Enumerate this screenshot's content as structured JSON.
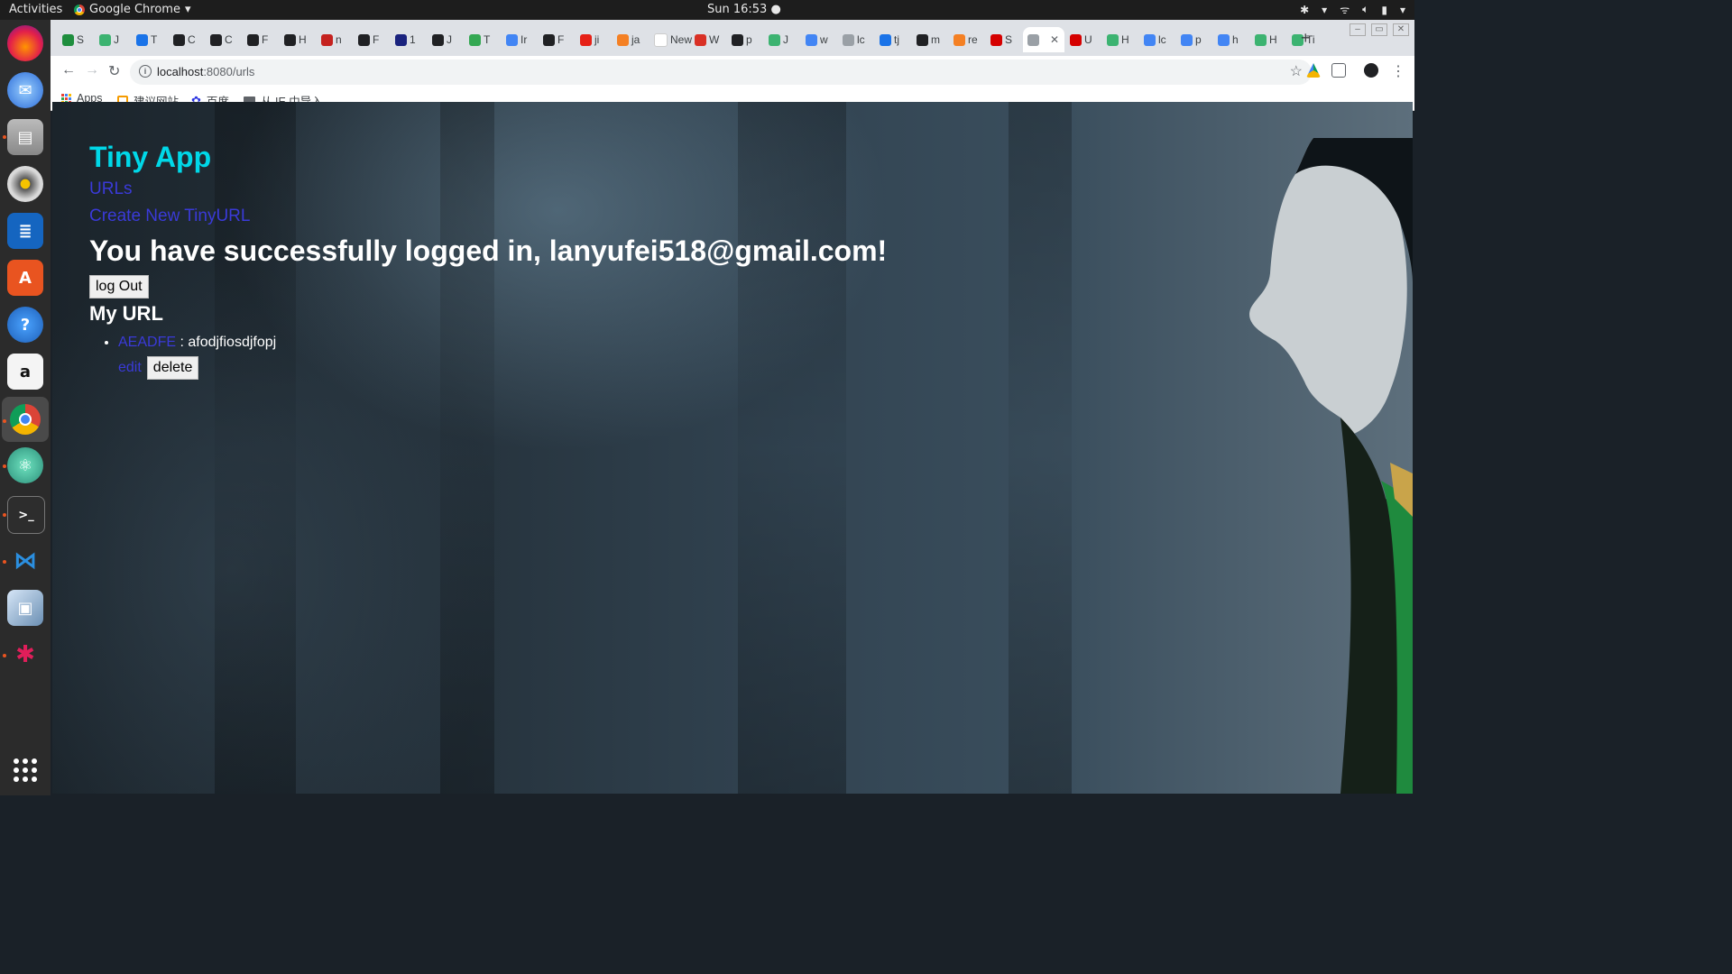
{
  "system_bar": {
    "activities": "Activities",
    "app_name": "Google Chrome",
    "clock": "Sun 16:53"
  },
  "dock": {
    "items": [
      "firefox-icon",
      "thunderbird-icon",
      "files-icon",
      "rhythmbox-icon",
      "writer-icon",
      "software-icon",
      "help-icon",
      "amazon-icon",
      "chrome-icon",
      "atom-icon",
      "terminal-icon",
      "vscode-icon",
      "image-viewer-icon",
      "slack-icon"
    ]
  },
  "browser": {
    "tabs": [
      {
        "label": "S",
        "color": "#1e8e3e"
      },
      {
        "label": "J",
        "color": "#3cb371"
      },
      {
        "label": "T",
        "color": "#1a73e8"
      },
      {
        "label": "C",
        "color": "#202124"
      },
      {
        "label": "C",
        "color": "#202124"
      },
      {
        "label": "F",
        "color": "#202124"
      },
      {
        "label": "H",
        "color": "#202124"
      },
      {
        "label": "n",
        "color": "#c5221f"
      },
      {
        "label": "F",
        "color": "#202124"
      },
      {
        "label": "1",
        "color": "#1a237e"
      },
      {
        "label": "J",
        "color": "#202124"
      },
      {
        "label": "T",
        "color": "#34a853"
      },
      {
        "label": "Ir",
        "color": "#4285f4"
      },
      {
        "label": "F",
        "color": "#202124"
      },
      {
        "label": "ji",
        "color": "#e62117"
      },
      {
        "label": "ja",
        "color": "#f48024"
      },
      {
        "label": "New",
        "color": "#ffffff"
      },
      {
        "label": "W",
        "color": "#d93025"
      },
      {
        "label": "p",
        "color": "#202124"
      },
      {
        "label": "J",
        "color": "#3cb371"
      },
      {
        "label": "w",
        "color": "#4285f4"
      },
      {
        "label": "lc",
        "color": "#9aa0a6"
      },
      {
        "label": "tj",
        "color": "#1a73e8"
      },
      {
        "label": "m",
        "color": "#202124"
      },
      {
        "label": "re",
        "color": "#f48024"
      },
      {
        "label": "S",
        "color": "#d50000"
      },
      {
        "label": "",
        "color": "#9aa0a6",
        "active": true
      },
      {
        "label": "U",
        "color": "#d50000"
      },
      {
        "label": "H",
        "color": "#3cb371"
      },
      {
        "label": "lc",
        "color": "#4285f4"
      },
      {
        "label": "p",
        "color": "#4285f4"
      },
      {
        "label": "h",
        "color": "#4285f4"
      },
      {
        "label": "H",
        "color": "#3cb371"
      },
      {
        "label": "Ti",
        "color": "#3cb371"
      }
    ],
    "url_host": "localhost",
    "url_path": ":8080/urls",
    "bookmarks": [
      "Apps",
      "建议网站",
      "百度",
      "从 IE 中导入"
    ]
  },
  "page": {
    "title": "Tiny App",
    "nav": {
      "urls": "URLs",
      "create": "Create New TinyURL"
    },
    "welcome": "You have successfully logged in, lanyufei518@gmail.com!",
    "logout_label": "log Out",
    "section_title": "My URL",
    "urls": [
      {
        "short": "AEADFE",
        "separator": " : ",
        "long": "afodjfiosdjfopj",
        "edit_label": "edit",
        "delete_label": "delete"
      }
    ]
  }
}
